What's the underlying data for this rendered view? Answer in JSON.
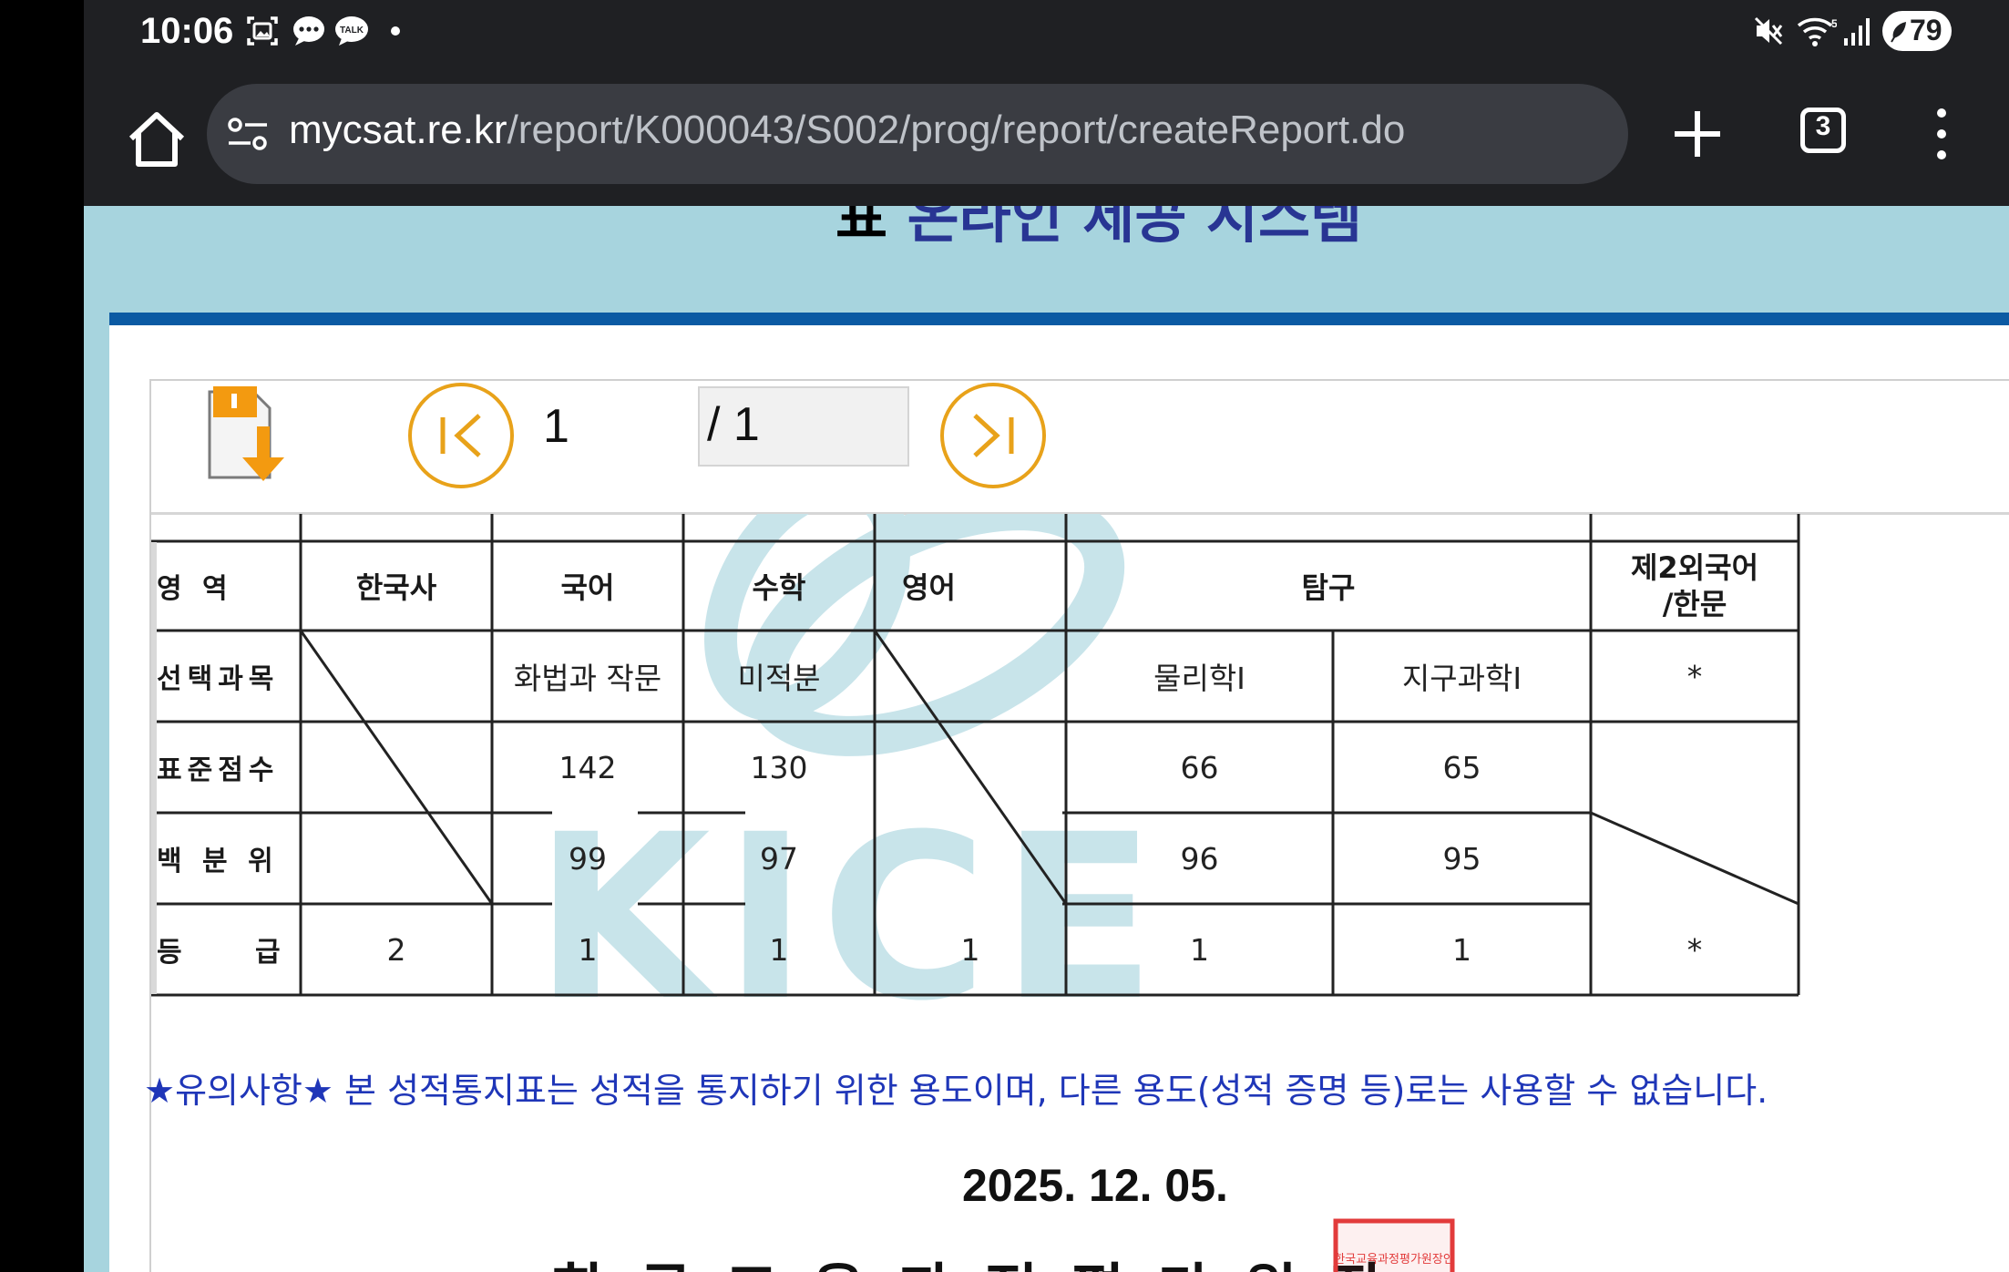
{
  "status_bar": {
    "time": "10:06",
    "battery": "79",
    "icons": [
      "screenshot-icon",
      "chat-bubble-icon",
      "talk-icon",
      "dot-icon",
      "mute-icon",
      "wifi-icon",
      "signal-icon",
      "battery-icon"
    ]
  },
  "browser": {
    "url_host": "mycsat.re.kr",
    "url_path": "/report/K000043/S002/prog/report/createReport.do",
    "tab_count": "3"
  },
  "page": {
    "banner_char": "표",
    "banner_title": "온라인 제공 시스템"
  },
  "viewer": {
    "current_page": "1",
    "total_pages": "/ 1"
  },
  "report": {
    "watermark": "KICE",
    "headers": {
      "area": "영 역",
      "korean_history": "한국사",
      "korean": "국어",
      "math": "수학",
      "english": "영어",
      "inquiry": "탐구",
      "second_lang_1": "제2외국어",
      "second_lang_2": "/한문"
    },
    "row_labels": {
      "subject": "선택과목",
      "std_score": "표준점수",
      "percentile": "백 분 위",
      "grade": "등 급"
    },
    "subjects": {
      "korean": "화법과 작문",
      "math": "미적분",
      "inquiry1": "물리학Ⅰ",
      "inquiry2": "지구과학Ⅰ",
      "second_lang": "*"
    },
    "std_scores": {
      "korean": "142",
      "math": "130",
      "inquiry1": "66",
      "inquiry2": "65"
    },
    "percentiles": {
      "korean": "99",
      "math": "97",
      "inquiry1": "96",
      "inquiry2": "95"
    },
    "grades": {
      "korean_history": "2",
      "korean": "1",
      "math": "1",
      "english": "1",
      "inquiry1": "1",
      "inquiry2": "1",
      "second_lang": "*"
    },
    "notice": "★유의사항★   본 성적통지표는 성적을 통지하기 위한 용도이며, 다른 용도(성적 증명 등)로는 사용할 수 없습니다.",
    "date": "2025. 12. 05.",
    "issuer": "한국교육과정평가원장",
    "seal_text": "한국교육과정평가원장인"
  },
  "colors": {
    "page_bg": "#a7d4de",
    "brand_blue": "#0b5aa3",
    "nav_orange": "#e8a21a",
    "notice_blue": "#1f36b8",
    "seal_red": "#e23b3b"
  }
}
